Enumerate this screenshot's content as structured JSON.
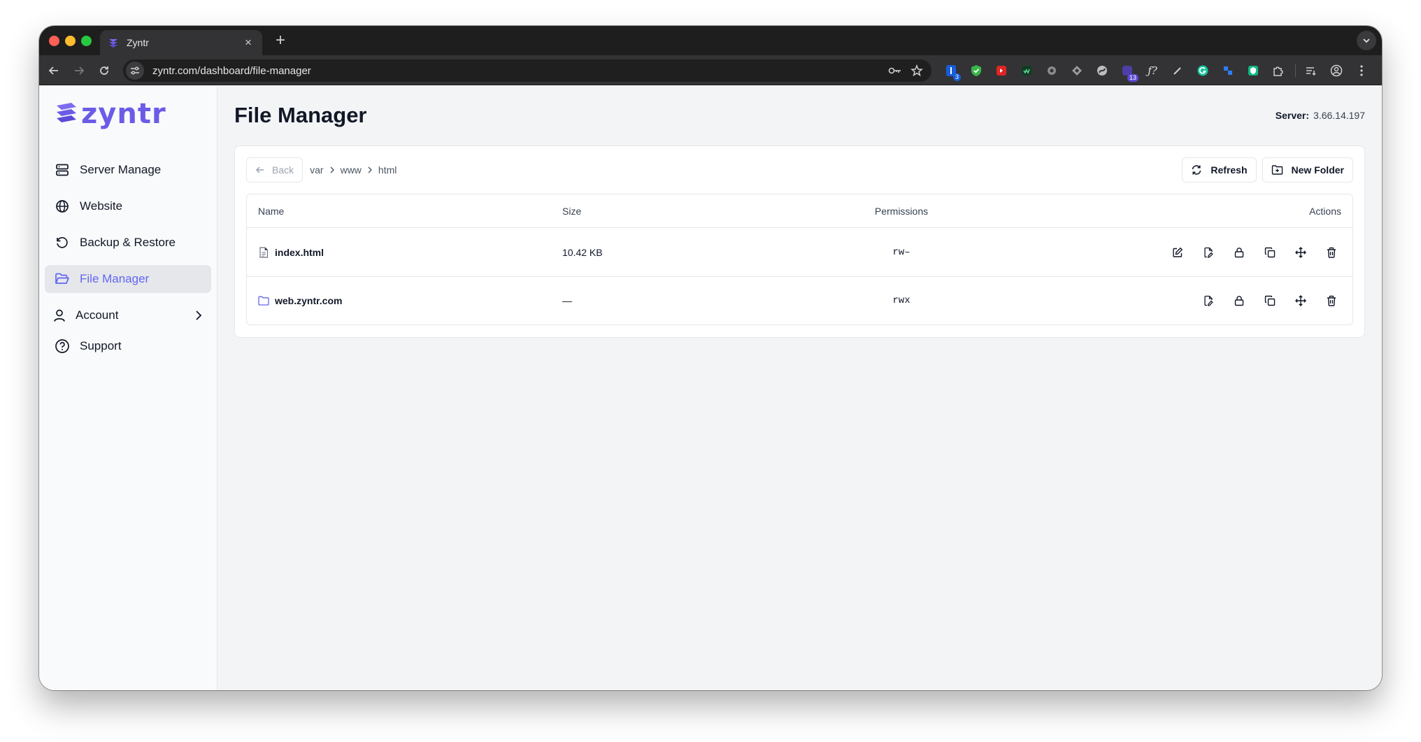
{
  "browser": {
    "tab_title": "Zyntr",
    "url": "zyntr.com/dashboard/file-manager",
    "ext_badges": {
      "bitwarden": "3",
      "notif": "13"
    }
  },
  "app": {
    "logo_text": "zyntr",
    "nav": [
      {
        "label": "Server Manage",
        "icon": "server-icon"
      },
      {
        "label": "Website",
        "icon": "globe-icon"
      },
      {
        "label": "Backup & Restore",
        "icon": "restore-icon"
      },
      {
        "label": "File Manager",
        "icon": "folder-icon",
        "active": true
      },
      {
        "label": "Account",
        "icon": "user-icon"
      },
      {
        "label": "Support",
        "icon": "help-icon"
      }
    ]
  },
  "page": {
    "title": "File Manager",
    "server_label": "Server:",
    "server_ip": "3.66.14.197"
  },
  "toolbar": {
    "back_label": "Back",
    "breadcrumb": [
      "var",
      "www",
      "html"
    ],
    "refresh_label": "Refresh",
    "new_folder_label": "New Folder"
  },
  "table": {
    "headers": {
      "name": "Name",
      "size": "Size",
      "permissions": "Permissions",
      "actions": "Actions"
    },
    "rows": [
      {
        "name": "index.html",
        "type": "file",
        "size": "10.42 KB",
        "permissions": "rw–"
      },
      {
        "name": "web.zyntr.com",
        "type": "folder",
        "size": "—",
        "permissions": "rwx"
      }
    ]
  },
  "colors": {
    "accent": "#6366f1",
    "logo": "#6b5ce7"
  }
}
